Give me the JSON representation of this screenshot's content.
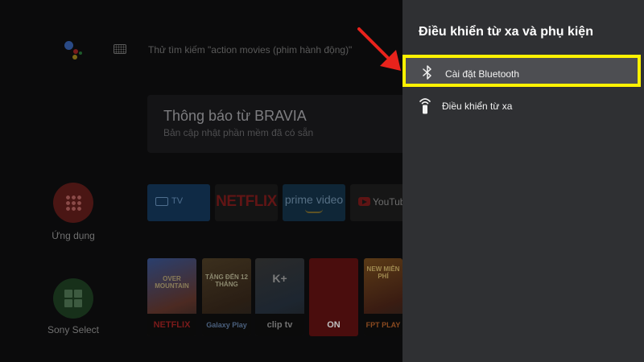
{
  "home": {
    "assistant_icon": "google-assistant-icon",
    "keyboard_icon": "keyboard-icon",
    "search_hint": "Thử tìm kiếm \"action movies (phim hành động)\"",
    "notification": {
      "title": "Thông báo từ BRAVIA",
      "subtitle": "Bản cập nhật phần mềm đã có sẵn"
    },
    "side_buttons": [
      {
        "label": "Ứng dụng",
        "icon": "apps-grid-icon"
      },
      {
        "label": "Sony Select",
        "icon": "sony-select-icon"
      }
    ],
    "app_tiles": [
      {
        "label": "TV",
        "icon": "tv-icon"
      },
      {
        "label": "NETFLIX"
      },
      {
        "label": "prime video"
      },
      {
        "label": "YouTube",
        "icon": "youtube-play-icon"
      }
    ],
    "content_cards": [
      {
        "art_text": "OVER MOUNTAIN",
        "brand": "NETFLIX"
      },
      {
        "art_text": "TẶNG ĐẾN 12 THÁNG",
        "brand": "Galaxy Play"
      },
      {
        "art_text": "K+",
        "brand": "clip tv"
      },
      {
        "art_text": "",
        "brand": "ON"
      },
      {
        "art_text": "NEW MIỄN PHÍ",
        "brand": "FPT PLAY"
      }
    ]
  },
  "panel": {
    "title": "Điều khiển từ xa và phụ kiện",
    "items": [
      {
        "label": "Cài đặt Bluetooth",
        "icon": "bluetooth-icon",
        "highlighted": true
      },
      {
        "label": "Điều khiển từ xa",
        "icon": "remote-control-icon",
        "highlighted": false
      }
    ]
  },
  "colors": {
    "panel_bg": "#2f3033",
    "highlight_border": "#fff200",
    "arrow": "#e8231c"
  }
}
